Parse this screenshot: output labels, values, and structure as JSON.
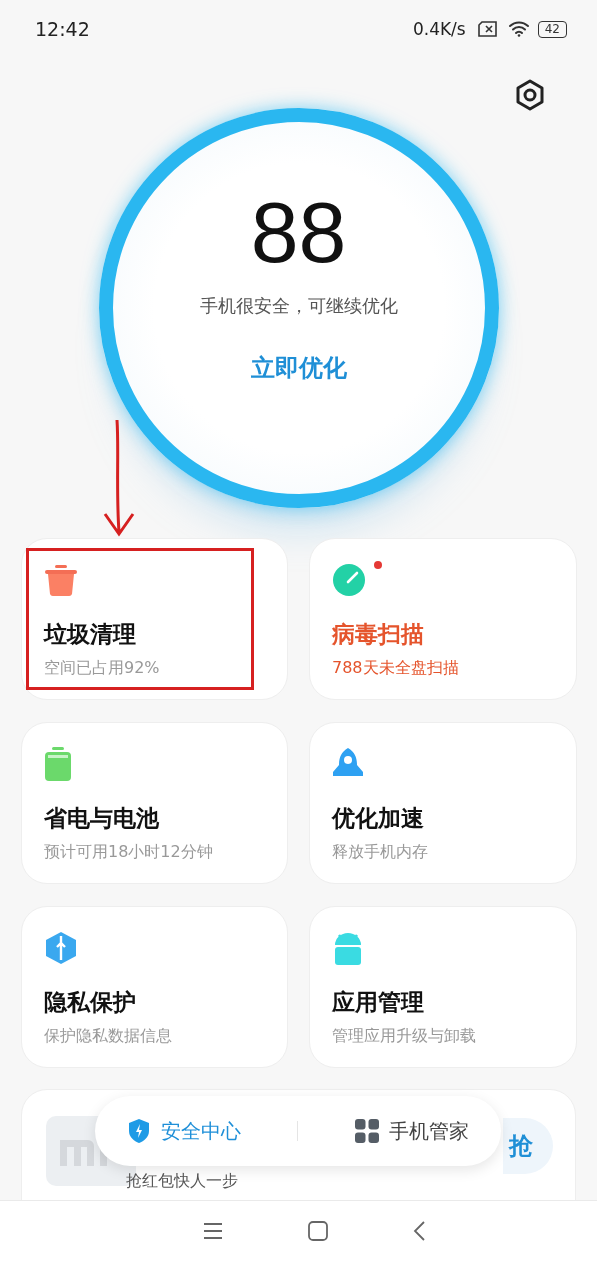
{
  "status_bar": {
    "time": "12:42",
    "speed": "0.4K/s",
    "battery": "42"
  },
  "score": {
    "value": "88",
    "message": "手机很安全，可继续优化",
    "action": "立即优化"
  },
  "cards": [
    {
      "title": "垃圾清理",
      "subtitle": "空间已占用92%",
      "alert": false,
      "highlighted": true
    },
    {
      "title": "病毒扫描",
      "subtitle": "788天未全盘扫描",
      "alert": true,
      "highlighted": false
    },
    {
      "title": "省电与电池",
      "subtitle": "预计可用18小时12分钟",
      "alert": false,
      "highlighted": false
    },
    {
      "title": "优化加速",
      "subtitle": "释放手机内存",
      "alert": false,
      "highlighted": false
    },
    {
      "title": "隐私保护",
      "subtitle": "保护隐私数据信息",
      "alert": false,
      "highlighted": false
    },
    {
      "title": "应用管理",
      "subtitle": "管理应用升级与卸载",
      "alert": false,
      "highlighted": false
    }
  ],
  "promo": {
    "subtitle": "抢红包快人一步",
    "button": "抢"
  },
  "bottom_tabs": [
    {
      "label": "安全中心",
      "selected": true
    },
    {
      "label": "手机管家",
      "selected": false
    }
  ]
}
